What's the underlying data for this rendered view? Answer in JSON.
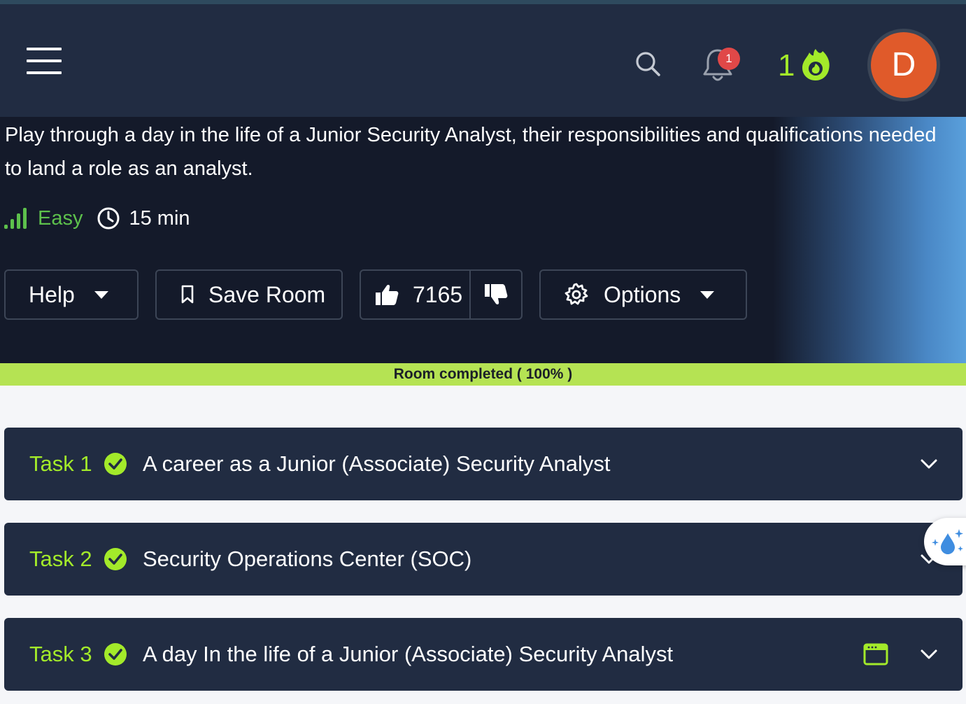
{
  "header": {
    "notification_count": "1",
    "streak_count": "1",
    "avatar_initial": "D",
    "icons": [
      "hamburger-menu-icon",
      "search-icon",
      "bell-icon",
      "flame-icon"
    ]
  },
  "room": {
    "description": "Play through a day in the life of a Junior Security Analyst, their responsibilities and qualifications needed to land a role as an analyst.",
    "difficulty": "Easy",
    "duration": "15 min"
  },
  "actions": {
    "help_label": "Help",
    "save_label": "Save Room",
    "like_count": "7165",
    "options_label": "Options"
  },
  "progress": {
    "label": "Room completed ( 100% )",
    "percent": 100
  },
  "tasks": [
    {
      "number": "Task 1",
      "title": "A career as a Junior (Associate) Security Analyst",
      "completed": true
    },
    {
      "number": "Task 2",
      "title": "Security Operations Center (SOC)",
      "completed": true
    },
    {
      "number": "Task 3",
      "title": "A day In the life of a Junior (Associate) Security Analyst",
      "completed": true
    }
  ],
  "colors": {
    "header_bg": "#212c42",
    "hero_bg": "#141a2a",
    "accent_green": "#a3ea2a",
    "progress_bg": "#b5e353",
    "avatar_bg": "#e05a2a",
    "badge_red": "#e04848"
  }
}
